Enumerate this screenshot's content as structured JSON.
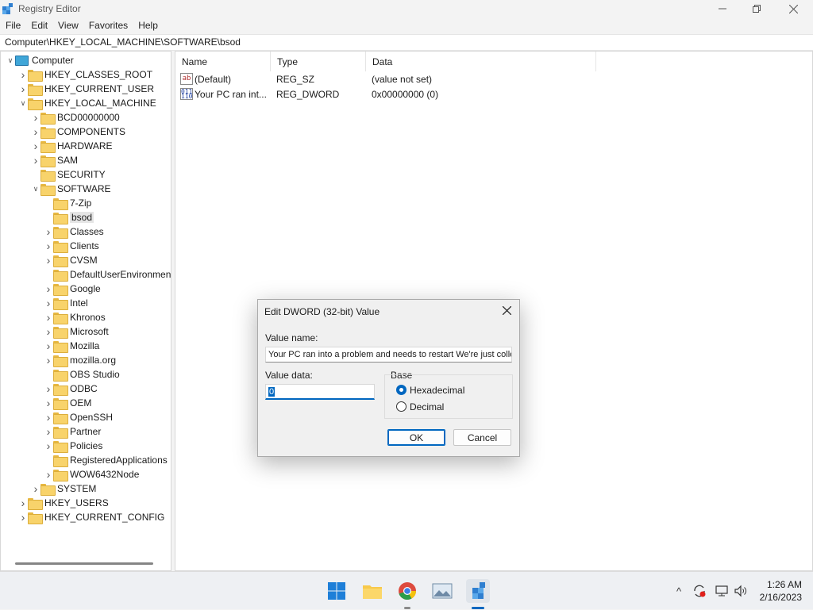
{
  "window": {
    "title": "Registry Editor"
  },
  "menu": [
    "File",
    "Edit",
    "View",
    "Favorites",
    "Help"
  ],
  "address": "Computer\\HKEY_LOCAL_MACHINE\\SOFTWARE\\bsod",
  "tree": [
    {
      "label": "Computer",
      "level": 0,
      "chevron": "down",
      "icon": "computer"
    },
    {
      "label": "HKEY_CLASSES_ROOT",
      "level": 1,
      "chevron": "right"
    },
    {
      "label": "HKEY_CURRENT_USER",
      "level": 1,
      "chevron": "right"
    },
    {
      "label": "HKEY_LOCAL_MACHINE",
      "level": 1,
      "chevron": "down"
    },
    {
      "label": "BCD00000000",
      "level": 2,
      "chevron": "right"
    },
    {
      "label": "COMPONENTS",
      "level": 2,
      "chevron": "right"
    },
    {
      "label": "HARDWARE",
      "level": 2,
      "chevron": "right"
    },
    {
      "label": "SAM",
      "level": 2,
      "chevron": "right"
    },
    {
      "label": "SECURITY",
      "level": 2,
      "chevron": ""
    },
    {
      "label": "SOFTWARE",
      "level": 2,
      "chevron": "down"
    },
    {
      "label": "7-Zip",
      "level": 3,
      "chevron": ""
    },
    {
      "label": "bsod",
      "level": 3,
      "chevron": "",
      "selected": true
    },
    {
      "label": "Classes",
      "level": 3,
      "chevron": "right"
    },
    {
      "label": "Clients",
      "level": 3,
      "chevron": "right"
    },
    {
      "label": "CVSM",
      "level": 3,
      "chevron": "right"
    },
    {
      "label": "DefaultUserEnvironmen",
      "level": 3,
      "chevron": ""
    },
    {
      "label": "Google",
      "level": 3,
      "chevron": "right"
    },
    {
      "label": "Intel",
      "level": 3,
      "chevron": "right"
    },
    {
      "label": "Khronos",
      "level": 3,
      "chevron": "right"
    },
    {
      "label": "Microsoft",
      "level": 3,
      "chevron": "right"
    },
    {
      "label": "Mozilla",
      "level": 3,
      "chevron": "right"
    },
    {
      "label": "mozilla.org",
      "level": 3,
      "chevron": "right"
    },
    {
      "label": "OBS Studio",
      "level": 3,
      "chevron": ""
    },
    {
      "label": "ODBC",
      "level": 3,
      "chevron": "right"
    },
    {
      "label": "OEM",
      "level": 3,
      "chevron": "right"
    },
    {
      "label": "OpenSSH",
      "level": 3,
      "chevron": "right"
    },
    {
      "label": "Partner",
      "level": 3,
      "chevron": "right"
    },
    {
      "label": "Policies",
      "level": 3,
      "chevron": "right"
    },
    {
      "label": "RegisteredApplications",
      "level": 3,
      "chevron": ""
    },
    {
      "label": "WOW6432Node",
      "level": 3,
      "chevron": "right"
    },
    {
      "label": "SYSTEM",
      "level": 2,
      "chevron": "right"
    },
    {
      "label": "HKEY_USERS",
      "level": 1,
      "chevron": "right"
    },
    {
      "label": "HKEY_CURRENT_CONFIG",
      "level": 1,
      "chevron": "right"
    }
  ],
  "columns": [
    "Name",
    "Type",
    "Data"
  ],
  "values": [
    {
      "icon": "ab",
      "name": "(Default)",
      "type": "REG_SZ",
      "data": "(value not set)"
    },
    {
      "icon": "011\n110",
      "name": "Your PC ran  int...",
      "type": "REG_DWORD",
      "data": "0x00000000 (0)"
    }
  ],
  "dialog": {
    "title": "Edit DWORD (32-bit) Value",
    "value_name_label": "Value name:",
    "value_name": "Your PC ran  into a problem and needs to restart We're just collec",
    "value_data_label": "Value data:",
    "value_data": "0",
    "base_label": "Base",
    "hex_label": "Hexadecimal",
    "dec_label": "Decimal",
    "ok": "OK",
    "cancel": "Cancel"
  },
  "clock": {
    "time": "1:26 AM",
    "date": "2/16/2023"
  },
  "colors": {
    "accent": "#0067c0",
    "folder": "#f8d36b"
  }
}
